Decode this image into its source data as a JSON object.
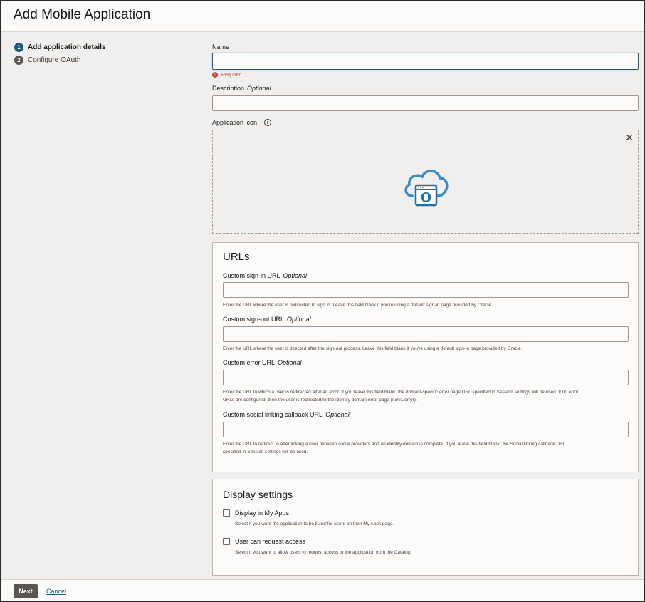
{
  "header": {
    "title": "Add Mobile Application"
  },
  "steps": [
    {
      "num": "1",
      "label": "Add application details"
    },
    {
      "num": "2",
      "label": "Configure OAuth"
    }
  ],
  "form": {
    "name": {
      "label": "Name",
      "value": "",
      "error": "Required"
    },
    "description": {
      "label": "Description",
      "optional": "Optional",
      "value": ""
    },
    "app_icon": {
      "label": "Application icon",
      "info_icon": "info-icon",
      "close_icon": "close-icon",
      "placeholder_icon": "cloud-mobile-app-icon"
    }
  },
  "urls": {
    "title": "URLs",
    "sign_in": {
      "label": "Custom sign-in URL",
      "optional": "Optional",
      "value": "",
      "help": "Enter the URL where the user is redirected to sign in. Leave this field blank if you're using a default sign-in page provided by Oracle."
    },
    "sign_out": {
      "label": "Custom sign-out URL",
      "optional": "Optional",
      "value": "",
      "help": "Enter the URL where the user is directed after the sign-out process. Leave this field blank if you're using a default sign-in page provided by Oracle."
    },
    "error": {
      "label": "Custom error URL",
      "optional": "Optional",
      "value": "",
      "help1": "Enter the URL to which a user is redirected after an error. If you leave this field blank, the domain-specific error page URL specified in Session settings will be used. If no error",
      "help2": "URLs are configured, then the user is redirected to the identity domain error page (/ui/v1/error)."
    },
    "social": {
      "label": "Custom social linking callback URL",
      "optional": "Optional",
      "value": "",
      "help1": "Enter the URL to redirect to after linking a user between social providers and an identity domain is complete. If you leave this field blank, the Social linking callback URL",
      "help2": "specified in Session settings will be used."
    }
  },
  "display": {
    "title": "Display settings",
    "my_apps": {
      "label": "Display in My Apps",
      "help": "Select if you want the application to be listed for users on their My Apps page.",
      "checked": false
    },
    "request_access": {
      "label": "User can request access",
      "help": "Select if you want to allow users to request access to the application from the Catalog.",
      "checked": false
    }
  },
  "footer": {
    "next_label": "Next",
    "cancel_label": "Cancel"
  },
  "colors": {
    "accent": "#1a5d7a",
    "error": "#c74634",
    "button": "#5a5652"
  }
}
